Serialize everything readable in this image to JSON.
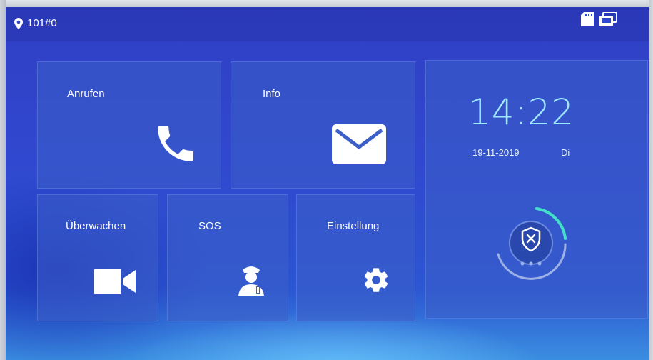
{
  "status": {
    "location_label": "101#0",
    "icons": [
      "location-pin-icon",
      "sd-card-icon",
      "monitor-icon"
    ]
  },
  "tiles": {
    "call": {
      "label": "Anrufen",
      "icon": "phone-icon"
    },
    "info": {
      "label": "Info",
      "icon": "envelope-icon"
    },
    "monitor": {
      "label": "Überwachen",
      "icon": "video-camera-icon"
    },
    "sos": {
      "label": "SOS",
      "icon": "guard-icon"
    },
    "settings": {
      "label": "Einstellung",
      "icon": "gear-icon"
    }
  },
  "clock": {
    "time": "14:22",
    "date": "19-11-2019",
    "weekday": "Di",
    "arm_icon": "shield-x-icon"
  },
  "colors": {
    "background": "#3048cf",
    "tile": "#3c5fc8",
    "clock_text": "#9fe9ff",
    "ring_accent": "#43e0c8"
  }
}
